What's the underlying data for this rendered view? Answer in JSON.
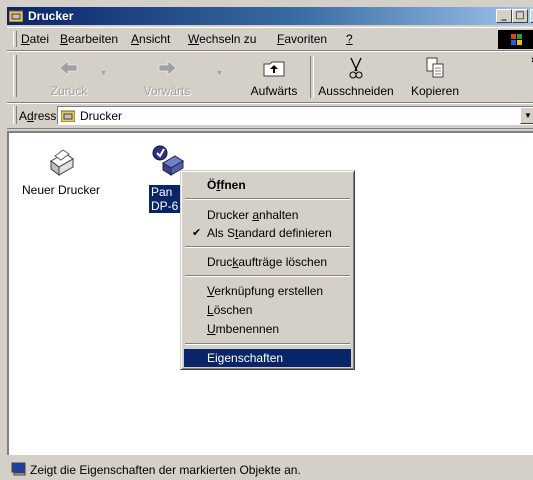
{
  "window": {
    "title": "Drucker",
    "controls": {
      "minimize": "_",
      "maximize": "□",
      "close": "×"
    }
  },
  "menu": [
    {
      "pre": "",
      "key": "D",
      "post": "atei"
    },
    {
      "pre": "",
      "key": "B",
      "post": "earbeiten"
    },
    {
      "pre": "",
      "key": "A",
      "post": "nsicht"
    },
    {
      "pre": "",
      "key": "W",
      "post": "echseln zu"
    },
    {
      "pre": "",
      "key": "F",
      "post": "avoriten"
    },
    {
      "pre": "",
      "key": "?",
      "post": ""
    }
  ],
  "toolbar": {
    "back": "Zurück",
    "forward": "Vorwärts",
    "up": "Aufwärts",
    "cut": "Ausschneiden",
    "copy": "Kopieren",
    "more": "»"
  },
  "address": {
    "label_pre": "A",
    "label_key": "d",
    "label_post": "resse",
    "value": "Drucker"
  },
  "items": [
    {
      "label": "Neuer Drucker"
    },
    {
      "label_line1": "Pan",
      "label_line2": "DP-6"
    }
  ],
  "context_menu": {
    "open": {
      "pre": "Ö",
      "key": "f",
      "post": "fnen"
    },
    "pause": {
      "pre": "Drucker ",
      "key": "a",
      "post": "nhalten"
    },
    "default": {
      "pre": "Als S",
      "key": "t",
      "post": "andard definieren",
      "check": "✔"
    },
    "purge": {
      "pre": "Druc",
      "key": "k",
      "post": "aufträge löschen"
    },
    "shortcut": {
      "pre": "",
      "key": "V",
      "post": "erknüpfung erstellen"
    },
    "delete": {
      "pre": "",
      "key": "L",
      "post": "öschen"
    },
    "rename": {
      "pre": "",
      "key": "U",
      "post": "mbenennen"
    },
    "properties": {
      "pre": "Ei",
      "key": "g",
      "post": "enschaften"
    }
  },
  "status": {
    "text": "Zeigt die Eigenschaften der markierten Objekte an."
  },
  "colors": {
    "title_start": "#0a246a",
    "title_end": "#a6caf0",
    "highlight": "#0a246a",
    "face": "#d4d0c8"
  }
}
